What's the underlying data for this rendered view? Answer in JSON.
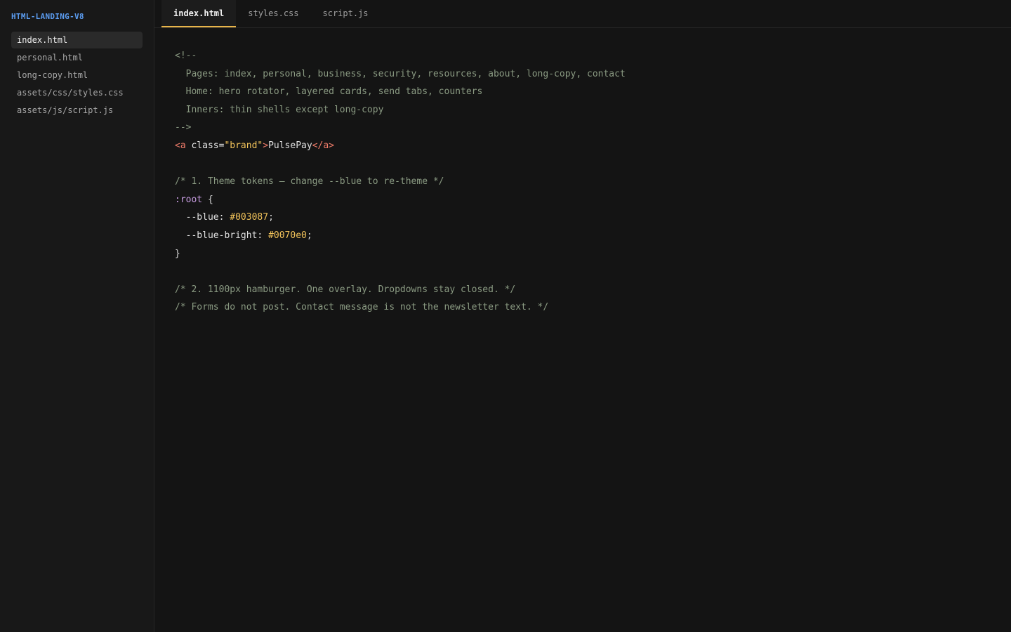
{
  "sidebar": {
    "project": "HTML-LANDING-V8",
    "files": [
      {
        "label": "index.html",
        "active": true
      },
      {
        "label": "personal.html",
        "active": false
      },
      {
        "label": "long-copy.html",
        "active": false
      },
      {
        "label": "assets/css/styles.css",
        "active": false
      },
      {
        "label": "assets/js/script.js",
        "active": false
      }
    ]
  },
  "tabs": [
    {
      "label": "index.html",
      "active": true
    },
    {
      "label": "styles.css",
      "active": false
    },
    {
      "label": "script.js",
      "active": false
    }
  ],
  "code": {
    "l1": "<!--",
    "l2": "  Pages: index, personal, business, security, resources, about, long-copy, contact",
    "l3": "  Home: hero rotator, layered cards, send tabs, counters",
    "l4": "  Inners: thin shells except long-copy",
    "l5": "-->",
    "l6": {
      "open_tag": "<a",
      "attr": " class=",
      "str": "\"brand\"",
      "close_bracket": ">",
      "text": "PulsePay",
      "end_tag": "</a>"
    },
    "l8": "/* 1. Theme tokens — change --blue to re-theme */",
    "l9": {
      "selector": ":root",
      "brace": " {"
    },
    "l10": {
      "prop": "  --blue: ",
      "value": "#003087",
      "semi": ";"
    },
    "l11": {
      "prop": "  --blue-bright: ",
      "value": "#0070e0",
      "semi": ";"
    },
    "l12": "}",
    "l14": "/* 2. 1100px hamburger. One overlay. Dropdowns stay closed. */",
    "l15": "/* Forms do not post. Contact message is not the newsletter text. */"
  },
  "colors": {
    "accent_tab": "#e8b54a",
    "project_title": "#5b9cf0",
    "comment": "#8a9a82",
    "tag": "#f07c6a",
    "string": "#f2c35a"
  }
}
